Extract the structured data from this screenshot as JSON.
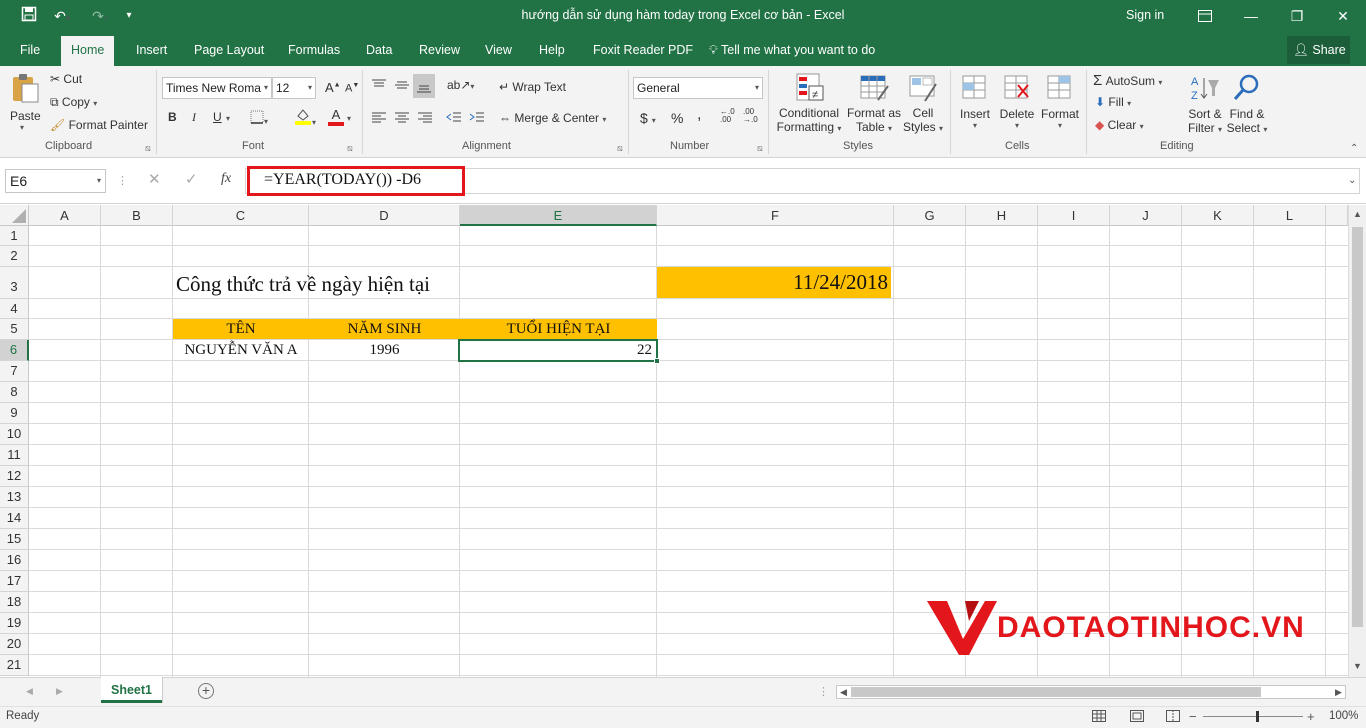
{
  "window": {
    "title": "hướng dẫn sử dụng hàm today trong Excel cơ bản  -  Excel",
    "sign_in": "Sign in",
    "share": "Share"
  },
  "tabs": [
    "File",
    "Home",
    "Insert",
    "Page Layout",
    "Formulas",
    "Data",
    "Review",
    "View",
    "Help",
    "Foxit Reader PDF"
  ],
  "tell_me": "Tell me what you want to do",
  "ribbon": {
    "clipboard": {
      "paste": "Paste",
      "cut": "Cut",
      "copy": "Copy",
      "format_painter": "Format Painter",
      "label": "Clipboard"
    },
    "font": {
      "name": "Times New Roma",
      "size": "12",
      "bold": "B",
      "italic": "I",
      "underline": "U",
      "label": "Font"
    },
    "alignment": {
      "wrap_text": "Wrap Text",
      "merge_center": "Merge & Center",
      "label": "Alignment"
    },
    "number": {
      "format": "General",
      "currency": "$",
      "percent": "%",
      "comma": ",",
      "label": "Number"
    },
    "styles": {
      "conditional_line1": "Conditional",
      "conditional_line2": "Formatting",
      "format_as_line1": "Format as",
      "format_as_line2": "Table",
      "cell_styles_line1": "Cell",
      "cell_styles_line2": "Styles",
      "label": "Styles"
    },
    "cells": {
      "insert": "Insert",
      "delete": "Delete",
      "format": "Format",
      "label": "Cells"
    },
    "editing": {
      "autosum": "AutoSum",
      "fill": "Fill",
      "clear": "Clear",
      "sort_line1": "Sort &",
      "sort_line2": "Filter",
      "find_line1": "Find &",
      "find_line2": "Select",
      "label": "Editing"
    }
  },
  "formula_bar": {
    "name_box": "E6",
    "fx": "fx",
    "formula": "=YEAR(TODAY()) -D6",
    "highlight_color": "#e3161c"
  },
  "columns": [
    "A",
    "B",
    "C",
    "D",
    "E",
    "F",
    "G",
    "H",
    "I",
    "J",
    "K",
    "L"
  ],
  "rows": [
    "1",
    "2",
    "3",
    "4",
    "5",
    "6",
    "7",
    "8",
    "9",
    "10",
    "11",
    "12",
    "13",
    "14",
    "15",
    "16",
    "17",
    "18",
    "19",
    "20",
    "21"
  ],
  "cells": {
    "C3": "Công thức trả về ngày hiện tại",
    "F3": "11/24/2018",
    "C5": "TÊN",
    "D5": "NĂM SINH",
    "E5": "TUỔI HIỆN TẠI",
    "C6": "NGUYỄN VĂN A",
    "D6": "1996",
    "E6": "22"
  },
  "highlight_fill": "#ffc000",
  "watermark": "DAOTAOTINHOC.VN",
  "sheet_tab": "Sheet1",
  "status": {
    "ready": "Ready",
    "zoom": "100%"
  },
  "colors": {
    "excel_green": "#217346",
    "selection": "#217346"
  }
}
